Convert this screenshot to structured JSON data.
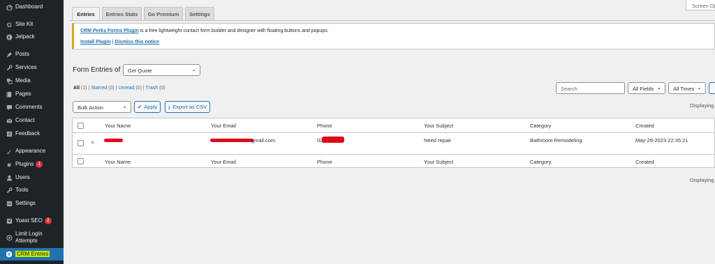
{
  "sidebar": {
    "items": [
      {
        "label": "Dashboard",
        "icon": "dashboard-icon"
      },
      {
        "label": "Site Kit",
        "icon": "site-kit-icon"
      },
      {
        "label": "Jetpack",
        "icon": "jetpack-icon"
      },
      {
        "label": "Posts",
        "icon": "pin-icon"
      },
      {
        "label": "Services",
        "icon": "wrench-icon"
      },
      {
        "label": "Media",
        "icon": "media-icon"
      },
      {
        "label": "Pages",
        "icon": "pages-icon"
      },
      {
        "label": "Comments",
        "icon": "comment-icon"
      },
      {
        "label": "Contact",
        "icon": "mail-icon"
      },
      {
        "label": "Feedback",
        "icon": "feedback-icon"
      },
      {
        "label": "Appearance",
        "icon": "brush-icon"
      },
      {
        "label": "Plugins",
        "icon": "plugin-icon",
        "badge": "1"
      },
      {
        "label": "Users",
        "icon": "user-icon"
      },
      {
        "label": "Tools",
        "icon": "tools-icon"
      },
      {
        "label": "Settings",
        "icon": "settings-icon"
      },
      {
        "label": "Yoast SEO",
        "icon": "yoast-icon",
        "badge": "2"
      },
      {
        "label": "Limit Login Attempts",
        "icon": "limit-login-icon"
      },
      {
        "label": "CRM Entries",
        "icon": "crm-icon",
        "current": true
      }
    ]
  },
  "tabs": [
    "Entries",
    "Entries Stats",
    "Go Premium",
    "Settings"
  ],
  "screen_options": "Screen Op",
  "notice": {
    "link": "CRM Perks Forms Plugin",
    "text": " is a free lightweight contact form builder and designer with floating buttons and popups.",
    "install": "Install Plugin",
    "sep": "|",
    "dismiss": "Dismiss this notice"
  },
  "form_title": "Form Entries of",
  "form_select": "Get Quote",
  "filters": {
    "all": "All",
    "all_count": "(1)",
    "starred": "Starred",
    "starred_count": "(0)",
    "unread": "Unread",
    "unread_count": "(0)",
    "trash": "Trash",
    "trash_count": "(0)",
    "sep": "|"
  },
  "search_placeholder": "Search",
  "field_select": "All Fields",
  "time_select": "All Times",
  "bulk_action": "Bulk Action",
  "apply": "Apply",
  "export": "Export as CSV",
  "displaying": "Displaying",
  "table": {
    "columns": [
      "Your Name",
      "Your Email",
      "Phone",
      "Your Subject",
      "Category",
      "Created"
    ],
    "rows": [
      {
        "name": "",
        "email": "gmail.com",
        "phone": "02",
        "subject": "Need repair",
        "category": "Bathroom Remodeling",
        "created": "May-28-2023 22:35:21"
      }
    ]
  },
  "colors": {
    "sidebar": "#1d2327",
    "accent": "#2271b1",
    "notice": "#dba617",
    "redact": "#e0091a",
    "highlight": "#c5e600"
  }
}
